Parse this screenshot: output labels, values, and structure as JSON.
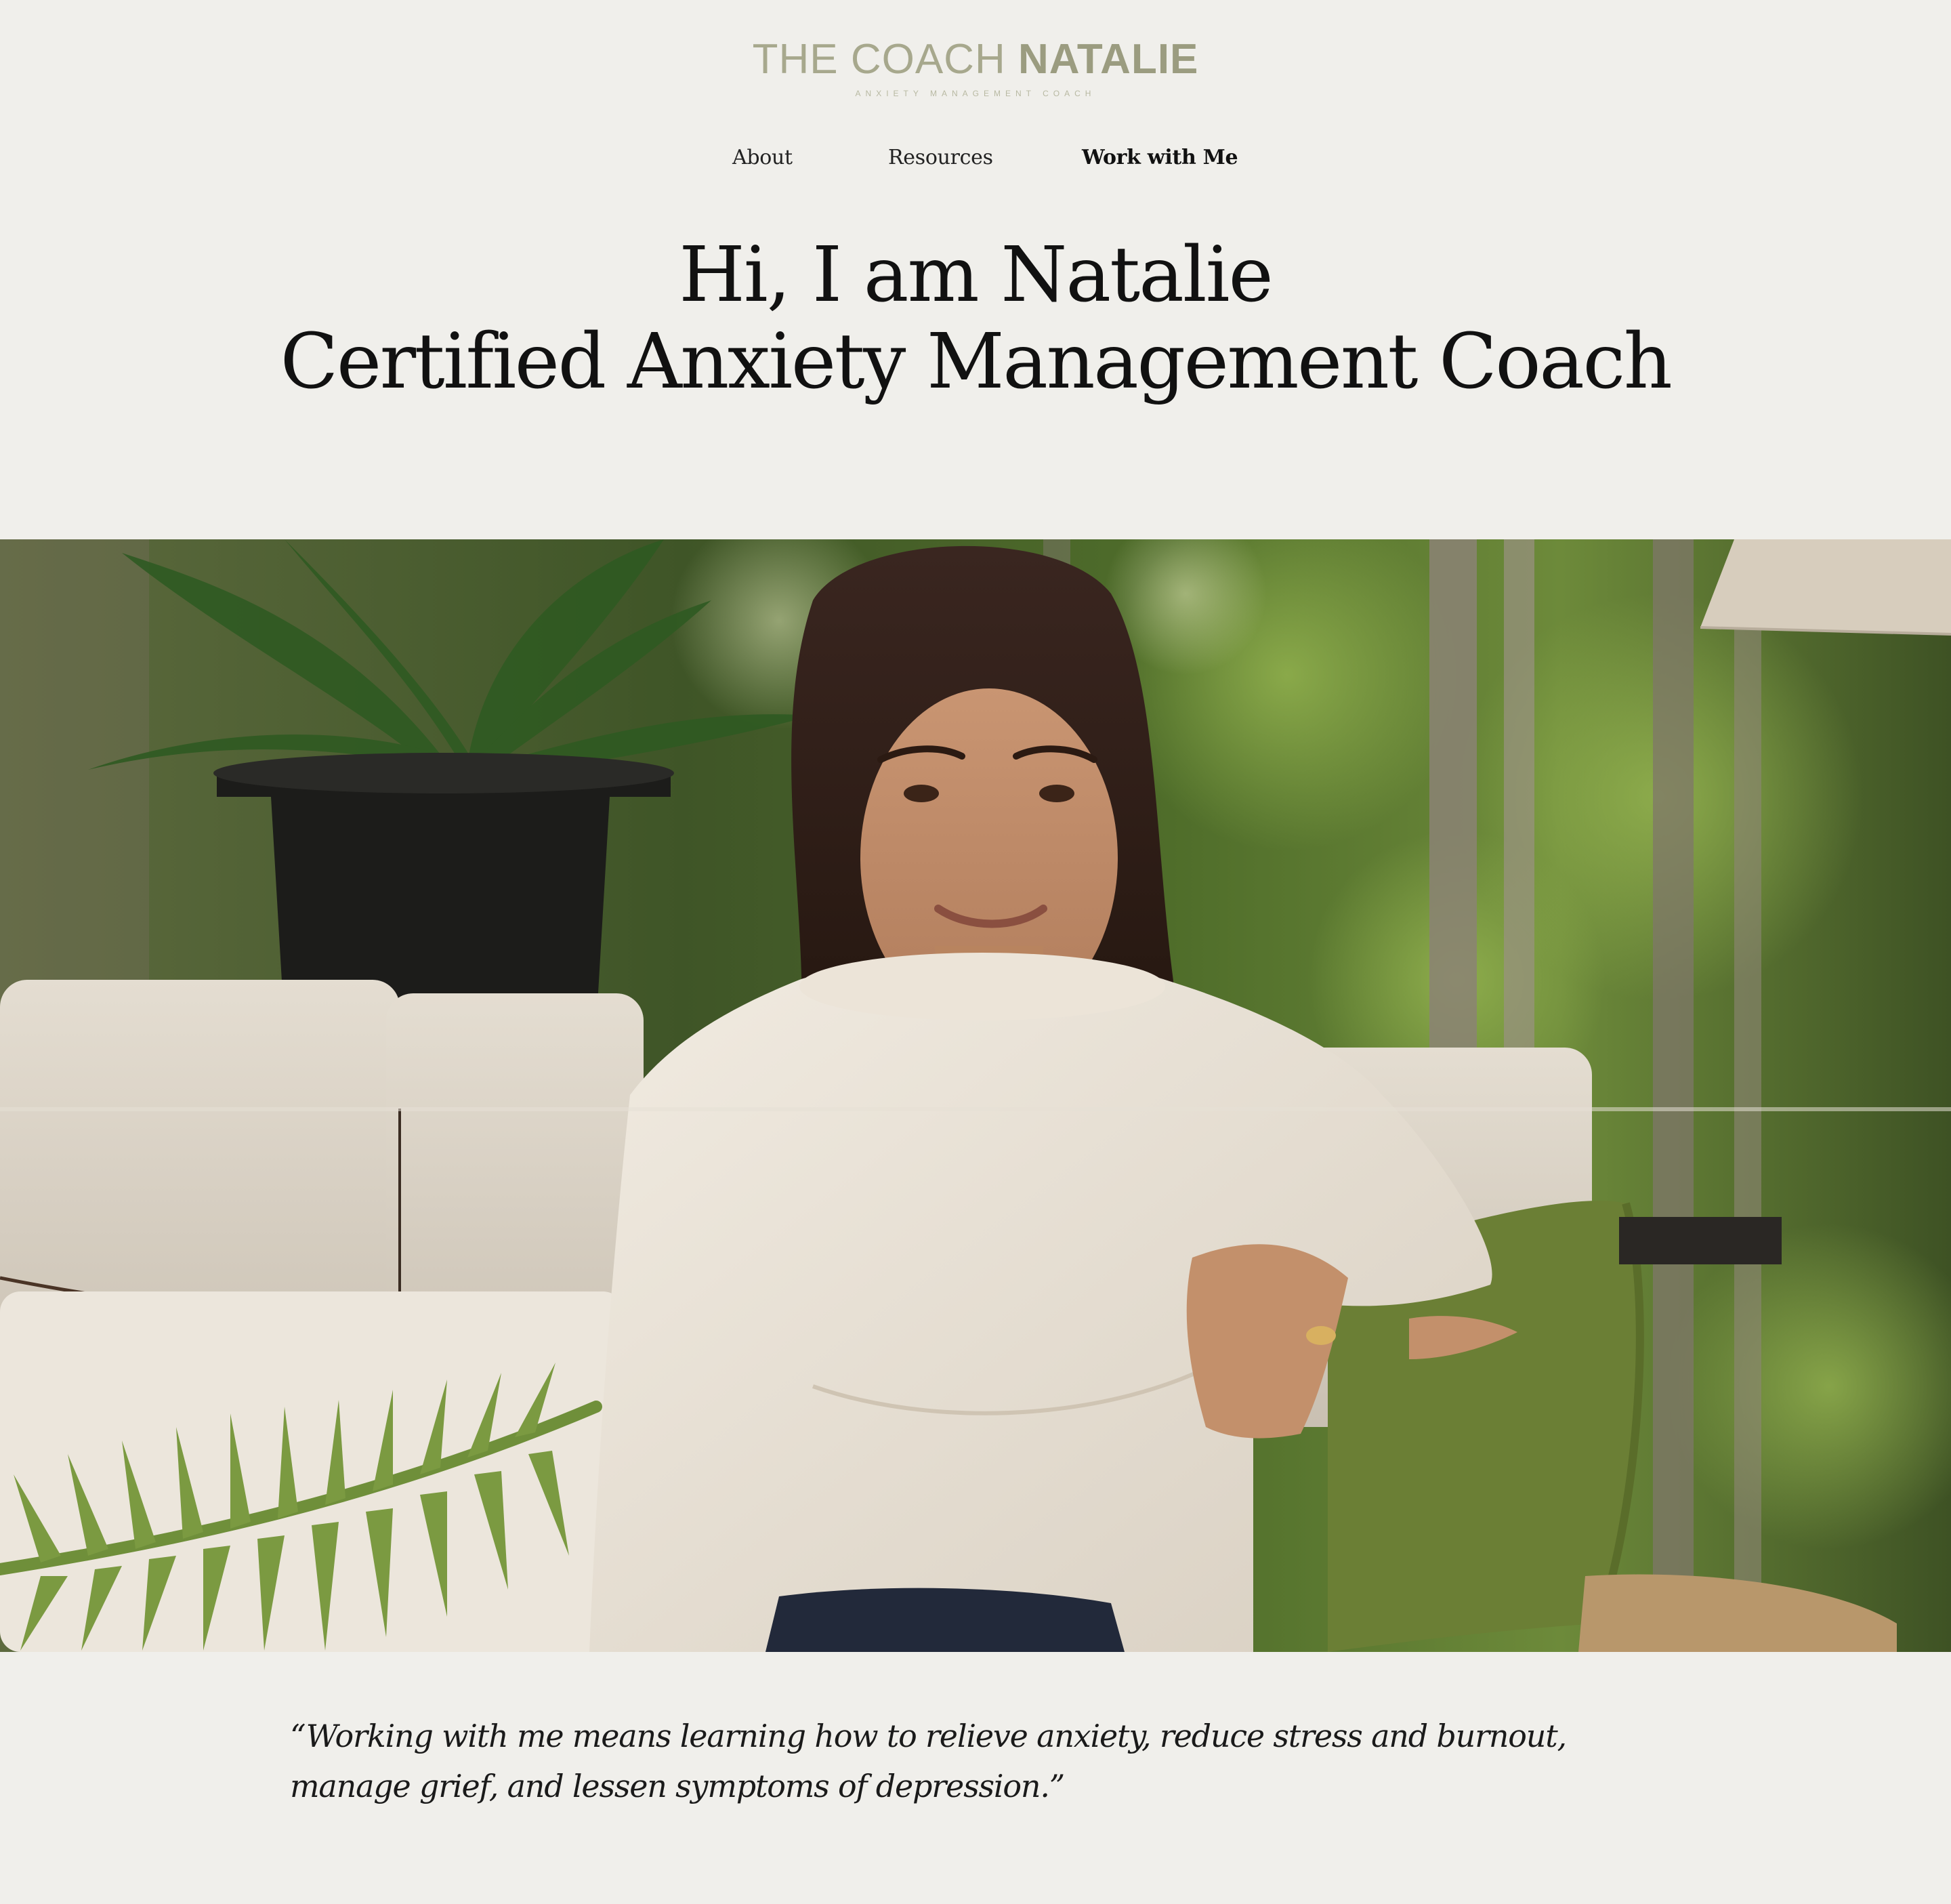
{
  "logo": {
    "main_light": "THE COACH ",
    "main_bold": "NATALIE",
    "tagline": "ANXIETY MANAGEMENT COACH"
  },
  "nav": {
    "items": [
      {
        "label": "About"
      },
      {
        "label": "Resources"
      },
      {
        "label": "Work with Me"
      }
    ]
  },
  "hero": {
    "line1": "Hi, I am Natalie",
    "line2": "Certified Anxiety Management Coach"
  },
  "quote": {
    "text": "“Working with me means learning how to relieve anxiety, reduce stress and burnout, manage grief, and lessen symptoms of depression.”"
  },
  "colors": {
    "background": "#f0efeb",
    "logo": "#a7a88d",
    "text": "#111111"
  }
}
